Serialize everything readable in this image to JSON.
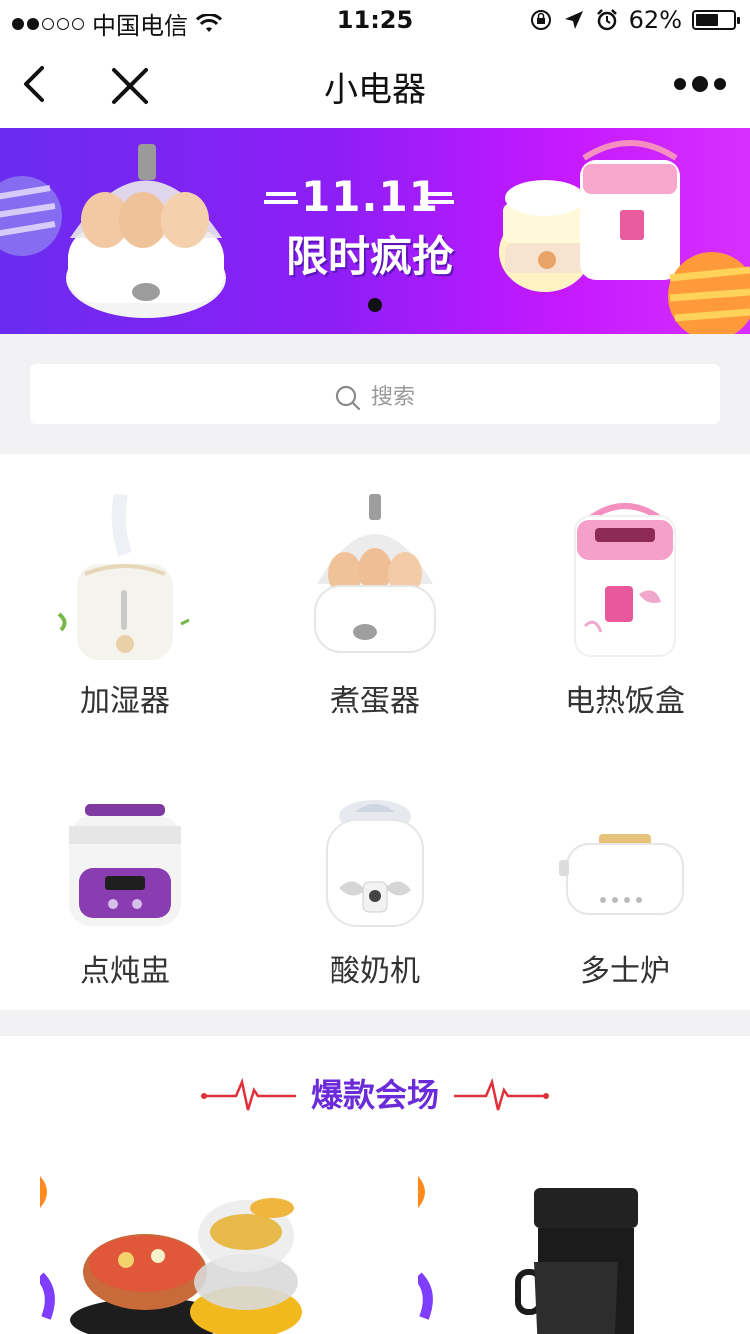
{
  "status_bar": {
    "carrier": "中国电信",
    "time": "11:25",
    "battery_percent": "62%",
    "battery_level": 0.62
  },
  "nav": {
    "title": "小电器"
  },
  "banner": {
    "date_text": "11.11",
    "slogan": "限时疯抢",
    "page_count": 1,
    "current_page": 1
  },
  "search": {
    "placeholder": "搜索"
  },
  "categories": [
    {
      "label": "加湿器",
      "icon": "humidifier"
    },
    {
      "label": "煮蛋器",
      "icon": "egg-cooker"
    },
    {
      "label": "电热饭盒",
      "icon": "electric-lunchbox"
    },
    {
      "label": "点炖盅",
      "icon": "stew-pot"
    },
    {
      "label": "酸奶机",
      "icon": "yogurt-maker"
    },
    {
      "label": "多士炉",
      "icon": "toaster"
    }
  ],
  "hot_section": {
    "title": "爆款会场",
    "products": [
      {
        "icon": "hot-pot-steamer"
      },
      {
        "icon": "coffee-maker"
      }
    ]
  },
  "colors": {
    "banner_start": "#6a2cf0",
    "banner_end": "#d72fff",
    "hot_title": "#6b2bd8",
    "hot_line": "#e0303a"
  }
}
